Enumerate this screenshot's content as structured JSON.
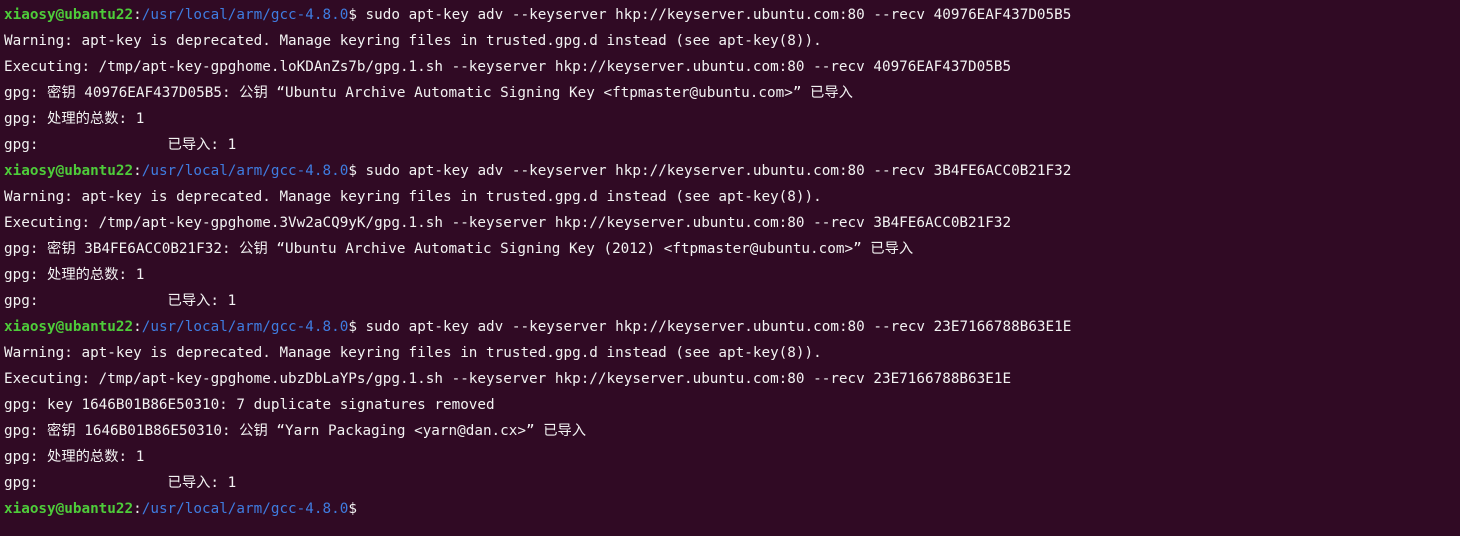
{
  "colors": {
    "background": "#300a24",
    "text": "#f2f2f2",
    "prompt_user": "#4ecc3a",
    "prompt_path": "#3f7ce0"
  },
  "prompt": {
    "user_host": "xiaosy@ubantu22",
    "colon": ":",
    "path": "/usr/local/arm/gcc-4.8.0",
    "symbol": "$"
  },
  "lines": [
    {
      "type": "prompt",
      "command": " sudo apt-key adv --keyserver hkp://keyserver.ubuntu.com:80 --recv 40976EAF437D05B5"
    },
    {
      "type": "output",
      "text": "Warning: apt-key is deprecated. Manage keyring files in trusted.gpg.d instead (see apt-key(8))."
    },
    {
      "type": "output",
      "text": "Executing: /tmp/apt-key-gpghome.loKDAnZs7b/gpg.1.sh --keyserver hkp://keyserver.ubuntu.com:80 --recv 40976EAF437D05B5"
    },
    {
      "type": "output",
      "text": "gpg: 密钥 40976EAF437D05B5: 公钥 “Ubuntu Archive Automatic Signing Key <ftpmaster@ubuntu.com>” 已导入"
    },
    {
      "type": "output",
      "text": "gpg: 处理的总数: 1"
    },
    {
      "type": "output",
      "text": "gpg:               已导入: 1"
    },
    {
      "type": "prompt",
      "command": " sudo apt-key adv --keyserver hkp://keyserver.ubuntu.com:80 --recv 3B4FE6ACC0B21F32"
    },
    {
      "type": "output",
      "text": "Warning: apt-key is deprecated. Manage keyring files in trusted.gpg.d instead (see apt-key(8))."
    },
    {
      "type": "output",
      "text": "Executing: /tmp/apt-key-gpghome.3Vw2aCQ9yK/gpg.1.sh --keyserver hkp://keyserver.ubuntu.com:80 --recv 3B4FE6ACC0B21F32"
    },
    {
      "type": "output",
      "text": "gpg: 密钥 3B4FE6ACC0B21F32: 公钥 “Ubuntu Archive Automatic Signing Key (2012) <ftpmaster@ubuntu.com>” 已导入"
    },
    {
      "type": "output",
      "text": "gpg: 处理的总数: 1"
    },
    {
      "type": "output",
      "text": "gpg:               已导入: 1"
    },
    {
      "type": "prompt",
      "command": " sudo apt-key adv --keyserver hkp://keyserver.ubuntu.com:80 --recv 23E7166788B63E1E"
    },
    {
      "type": "output",
      "text": "Warning: apt-key is deprecated. Manage keyring files in trusted.gpg.d instead (see apt-key(8))."
    },
    {
      "type": "output",
      "text": "Executing: /tmp/apt-key-gpghome.ubzDbLaYPs/gpg.1.sh --keyserver hkp://keyserver.ubuntu.com:80 --recv 23E7166788B63E1E"
    },
    {
      "type": "output",
      "text": "gpg: key 1646B01B86E50310: 7 duplicate signatures removed"
    },
    {
      "type": "output",
      "text": "gpg: 密钥 1646B01B86E50310: 公钥 “Yarn Packaging <yarn@dan.cx>” 已导入"
    },
    {
      "type": "output",
      "text": "gpg: 处理的总数: 1"
    },
    {
      "type": "output",
      "text": "gpg:               已导入: 1"
    },
    {
      "type": "prompt",
      "command": ""
    }
  ]
}
